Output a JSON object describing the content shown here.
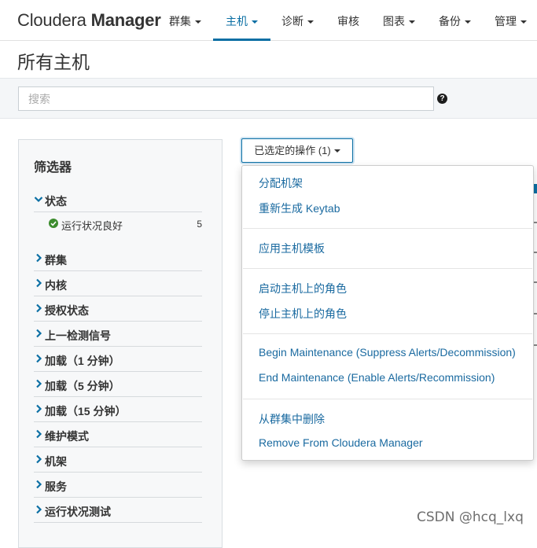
{
  "brand": {
    "part1": "Cloudera ",
    "part2": "Manager"
  },
  "nav": [
    {
      "label": "群集",
      "has_caret": true,
      "active": false
    },
    {
      "label": "主机",
      "has_caret": true,
      "active": true
    },
    {
      "label": "诊断",
      "has_caret": true,
      "active": false
    },
    {
      "label": "审核",
      "has_caret": false,
      "active": false
    },
    {
      "label": "图表",
      "has_caret": true,
      "active": false
    },
    {
      "label": "备份",
      "has_caret": true,
      "active": false
    },
    {
      "label": "管理",
      "has_caret": true,
      "active": false
    }
  ],
  "page_title": "所有主机",
  "search": {
    "placeholder": "搜索",
    "value": "",
    "help_icon": "question-circle-icon"
  },
  "filters": {
    "title": "筛选器",
    "status": {
      "label": "状态",
      "expanded": true,
      "items": [
        {
          "label": "运行状况良好",
          "count": "5",
          "icon": "check-circle-icon",
          "color": "#3c8c2e"
        }
      ]
    },
    "facets": [
      "群集",
      "内核",
      "授权状态",
      "上一检测信号",
      "加载（1 分钟）",
      "加载（5 分钟）",
      "加载（15 分钟）",
      "维护模式",
      "机架",
      "服务",
      "运行状况测试"
    ]
  },
  "actions_button": {
    "label": "已选定的操作 (1)"
  },
  "actions_menu": {
    "groups": [
      [
        "分配机架",
        "重新生成 Keytab"
      ],
      [
        "应用主机模板"
      ],
      [
        "启动主机上的角色",
        "停止主机上的角色"
      ],
      [
        "Begin Maintenance (Suppress Alerts/Decommission)",
        "End Maintenance (Enable Alerts/Recommission)"
      ],
      [
        "从群集中删除",
        "Remove From Cloudera Manager"
      ]
    ]
  },
  "watermark": "CSDN @hcq_lxq",
  "colors": {
    "accent": "#0b6fa4",
    "link": "#1a6aa0",
    "ok": "#3c8c2e"
  }
}
